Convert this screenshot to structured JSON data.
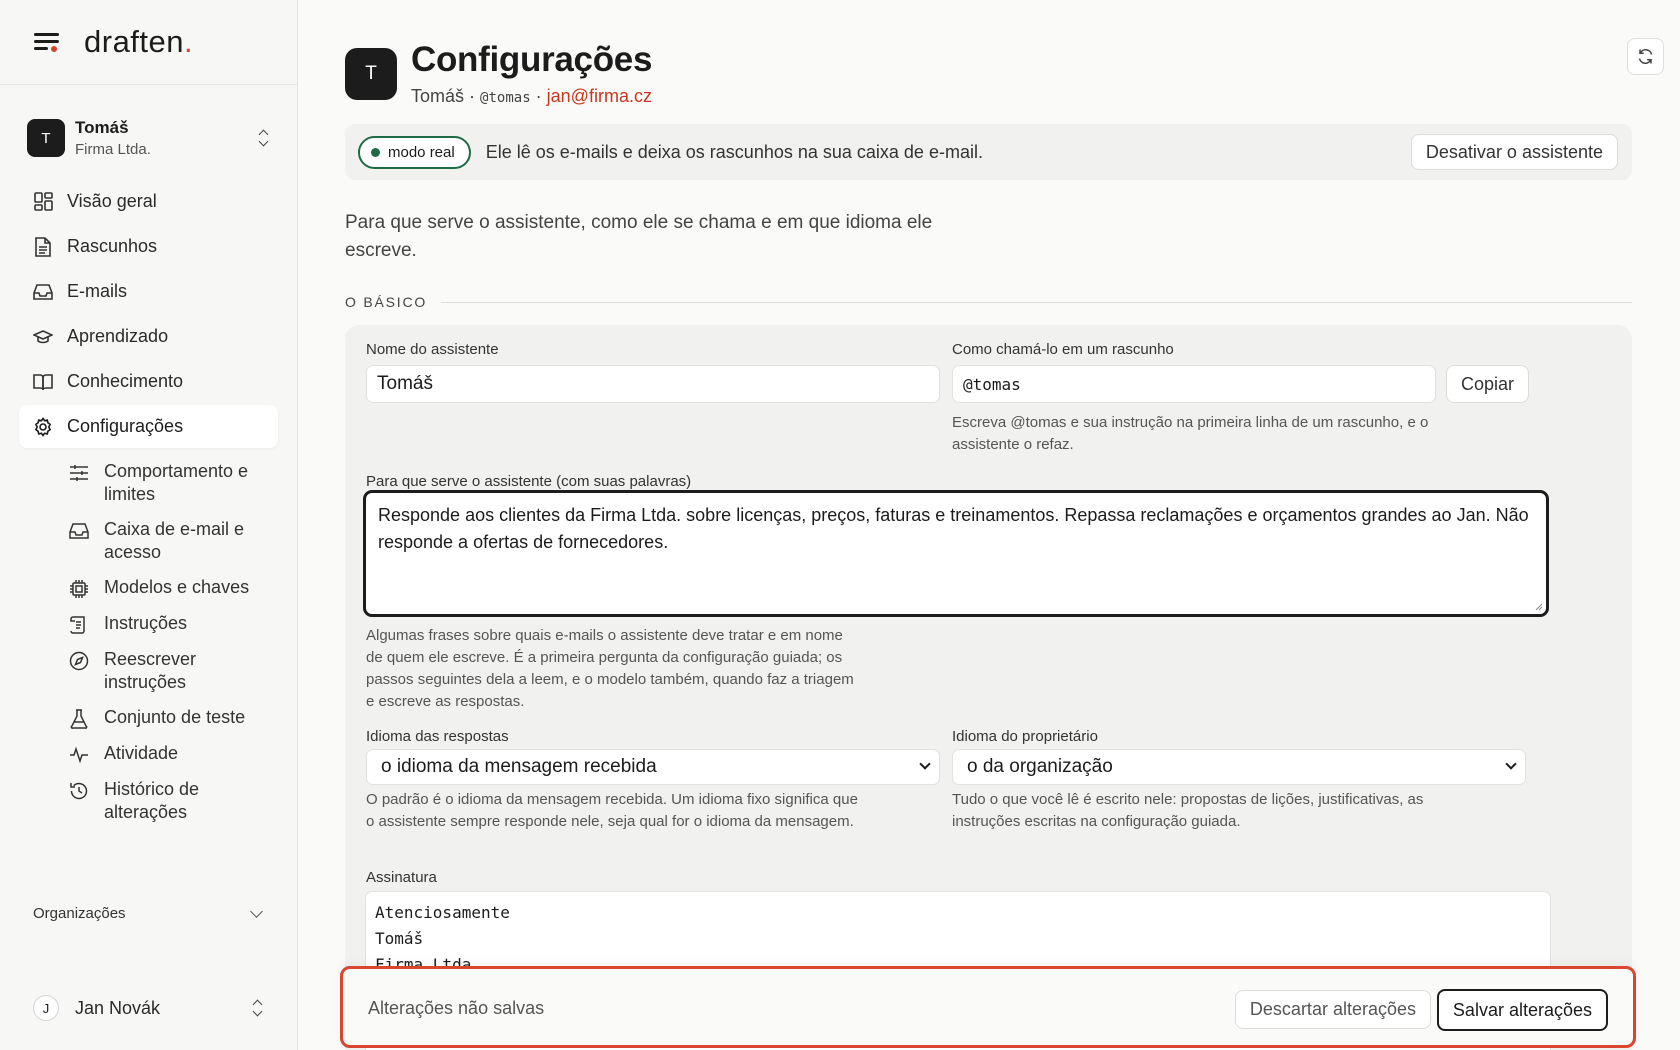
{
  "brand": {
    "name": "draften",
    "dot": "."
  },
  "account": {
    "initial": "T",
    "name": "Tomáš",
    "org": "Firma Ltda."
  },
  "nav": {
    "items": [
      {
        "label": "Visão geral",
        "icon": "dashboard-icon"
      },
      {
        "label": "Rascunhos",
        "icon": "document-icon"
      },
      {
        "label": "E-mails",
        "icon": "inbox-icon"
      },
      {
        "label": "Aprendizado",
        "icon": "graduation-cap-icon"
      },
      {
        "label": "Conhecimento",
        "icon": "book-icon"
      },
      {
        "label": "Configurações",
        "icon": "gear-icon",
        "active": true
      }
    ],
    "sub_items": [
      {
        "label": "Comportamento e limites",
        "icon": "sliders-icon"
      },
      {
        "label": "Caixa de e-mail e acesso",
        "icon": "inbox-icon"
      },
      {
        "label": "Modelos e chaves",
        "icon": "chip-icon"
      },
      {
        "label": "Instruções",
        "icon": "scroll-icon"
      },
      {
        "label": "Reescrever instruções",
        "icon": "compass-icon"
      },
      {
        "label": "Conjunto de teste",
        "icon": "flask-icon"
      },
      {
        "label": "Atividade",
        "icon": "activity-icon"
      },
      {
        "label": "Histórico de alterações",
        "icon": "history-icon"
      }
    ]
  },
  "organizations": {
    "label": "Organizações"
  },
  "user": {
    "initial": "J",
    "name": "Jan Novák"
  },
  "header": {
    "avatar": "T",
    "title": "Configurações",
    "name": "Tomáš",
    "sep": "·",
    "handle": "@tomas",
    "email": "jan@firma.cz"
  },
  "banner": {
    "status": "modo real",
    "text": "Ele lê os e-mails e deixa os rascunhos na sua caixa de e-mail.",
    "button": "Desativar o assistente"
  },
  "intro": "Para que serve o assistente, como ele se chama e em que idioma ele escreve.",
  "section": {
    "label": "O BÁSICO"
  },
  "form": {
    "name_label": "Nome do assistente",
    "name_value": "Tomáš",
    "call_label": "Como chamá-lo em um rascunho",
    "call_value": "@tomas",
    "copy": "Copiar",
    "call_help": "Escreva @tomas e sua instrução na primeira linha de um rascunho, e o assistente o refaz.",
    "purpose_label": "Para que serve o assistente (com suas palavras)",
    "purpose_value": "Responde aos clientes da Firma Ltda. sobre licenças, preços, faturas e treinamentos. Repassa reclamações e orçamentos grandes ao Jan. Não responde a ofertas de fornecedores.",
    "purpose_help": "Algumas frases sobre quais e-mails o assistente deve tratar e em nome de quem ele escreve. É a primeira pergunta da configuração guiada; os passos seguintes dela a leem, e o modelo também, quando faz a triagem e escreve as respostas.",
    "reply_lang_label": "Idioma das respostas",
    "reply_lang_value": "o idioma da mensagem recebida",
    "reply_lang_help": "O padrão é o idioma da mensagem recebida. Um idioma fixo significa que o assistente sempre responde nele, seja qual for o idioma da mensagem.",
    "owner_lang_label": "Idioma do proprietário",
    "owner_lang_value": "o da organização",
    "owner_lang_help": "Tudo o que você lê é escrito nele: propostas de lições, justificativas, as instruções escritas na configuração guiada.",
    "signature_label": "Assinatura",
    "signature_value": "Atenciosamente\nTomáš\nFirma Ltda."
  },
  "savebar": {
    "status": "Alterações não salvas",
    "discard": "Descartar alterações",
    "save": "Salvar alterações"
  },
  "colors": {
    "accent": "#d9412b",
    "live_green": "#1f6b45",
    "email": "#c8371f"
  }
}
